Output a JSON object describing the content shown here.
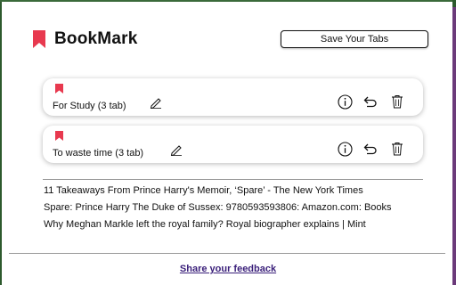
{
  "app": {
    "name": "BookMark"
  },
  "header": {
    "save_button_label": "Save Your Tabs"
  },
  "colors": {
    "accent": "#e8394f",
    "link": "#3a1f7a",
    "frame_left": "#2d5a2d",
    "frame_right": "#6b3a7a"
  },
  "groups": [
    {
      "label": "For Study (3 tab)",
      "icons": [
        "bookmark-flag-icon",
        "edit-pencil-icon",
        "info-icon",
        "undo-icon",
        "trash-icon"
      ]
    },
    {
      "label": "To waste time (3 tab)",
      "icons": [
        "bookmark-flag-icon",
        "edit-pencil-icon",
        "info-icon",
        "undo-icon",
        "trash-icon"
      ]
    }
  ],
  "open_tabs": [
    "11 Takeaways From Prince Harry's Memoir, ‘Spare’ - The New York Times",
    "Spare: Prince Harry The Duke of Sussex: 9780593593806: Amazon.com: Books",
    "Why Meghan Markle left the royal family? Royal biographer explains | Mint"
  ],
  "footer": {
    "feedback_label": "Share your feedback"
  }
}
